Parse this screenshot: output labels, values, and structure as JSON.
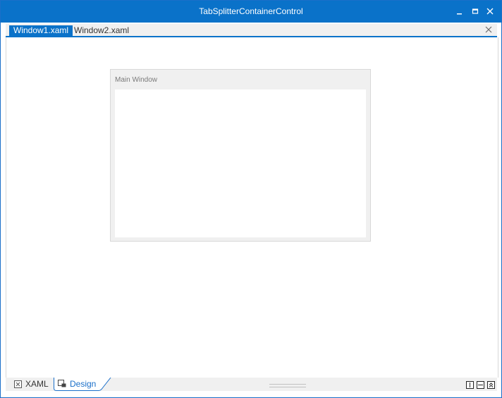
{
  "window": {
    "title": "TabSplitterContainerControl"
  },
  "caption_buttons": [
    {
      "name": "minimize",
      "icon": "minimize-icon"
    },
    {
      "name": "maximize",
      "icon": "maximize-icon"
    },
    {
      "name": "close",
      "icon": "close-icon"
    }
  ],
  "document_tabs": [
    {
      "label": "Window1.xaml",
      "active": true
    },
    {
      "label": "Window2.xaml",
      "active": false
    }
  ],
  "designer": {
    "preview_title": "Main Window"
  },
  "view_tabs": [
    {
      "label": "XAML",
      "icon": "xaml-icon",
      "active": false
    },
    {
      "label": "Design",
      "icon": "design-icon",
      "active": true
    }
  ],
  "split_buttons": [
    {
      "name": "vertical-split",
      "icon": "vertical-split-icon"
    },
    {
      "name": "horizontal-split",
      "icon": "horizontal-split-icon"
    },
    {
      "name": "collapse-pane",
      "icon": "collapse-pane-icon"
    }
  ],
  "colors": {
    "accent": "#0a72c9",
    "chrome": "#f0f0f0",
    "border": "#d8d8d8"
  }
}
